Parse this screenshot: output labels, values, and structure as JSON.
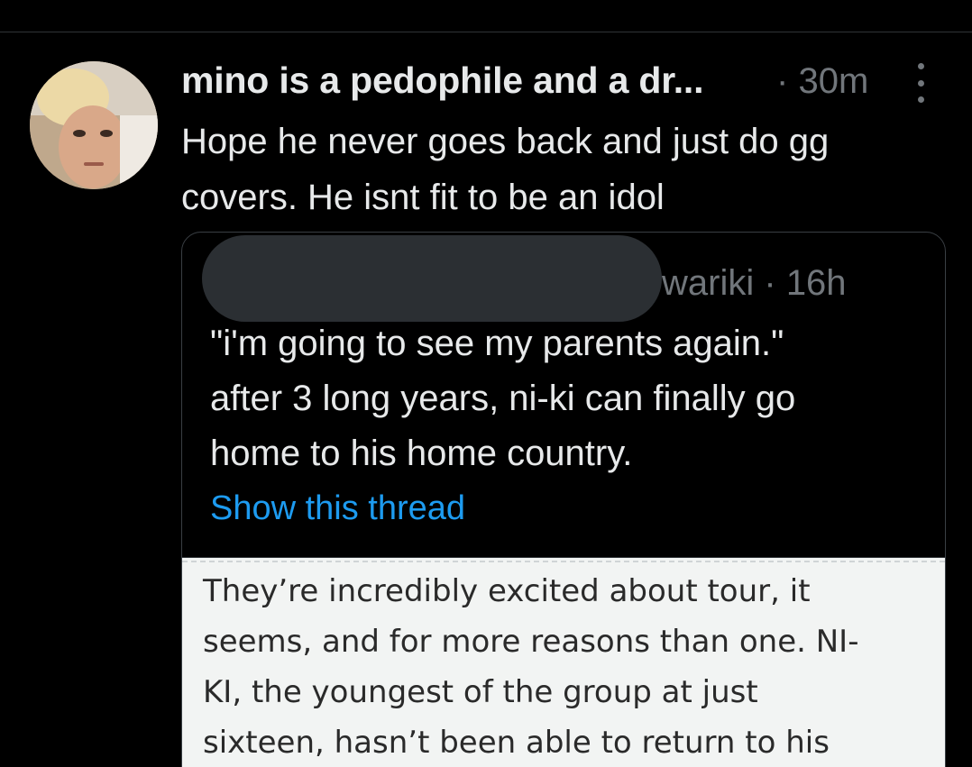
{
  "tweet": {
    "display_name": "mino is a pedophile and a dr...",
    "separator": "·",
    "timestamp": "30m",
    "text_lines": [
      "Hope he never goes back and just do gg",
      "covers. He isnt fit to be an idol"
    ],
    "avatar_icon": "profile-photo",
    "more_icon": "more-options-vertical-icon"
  },
  "quote": {
    "author_handle_visible": "wariki",
    "separator": "·",
    "timestamp": "16h",
    "text_lines": [
      "\"i'm going to see my parents again.\"",
      "after 3 long years, ni-ki can finally go",
      "home to his home country."
    ],
    "show_thread_label": "Show this thread",
    "image_text_lines": [
      "They’re incredibly excited about tour, it",
      "seems, and for more reasons than one. NI-",
      "KI, the youngest of the group at just",
      "sixteen, hasn’t been able to return to his"
    ]
  },
  "colors": {
    "background": "#000000",
    "primary_text": "#e7e9ea",
    "secondary_text": "#71767b",
    "link": "#1d9bf0",
    "redaction": "#2b2f33",
    "article_background": "#f2f4f3"
  }
}
